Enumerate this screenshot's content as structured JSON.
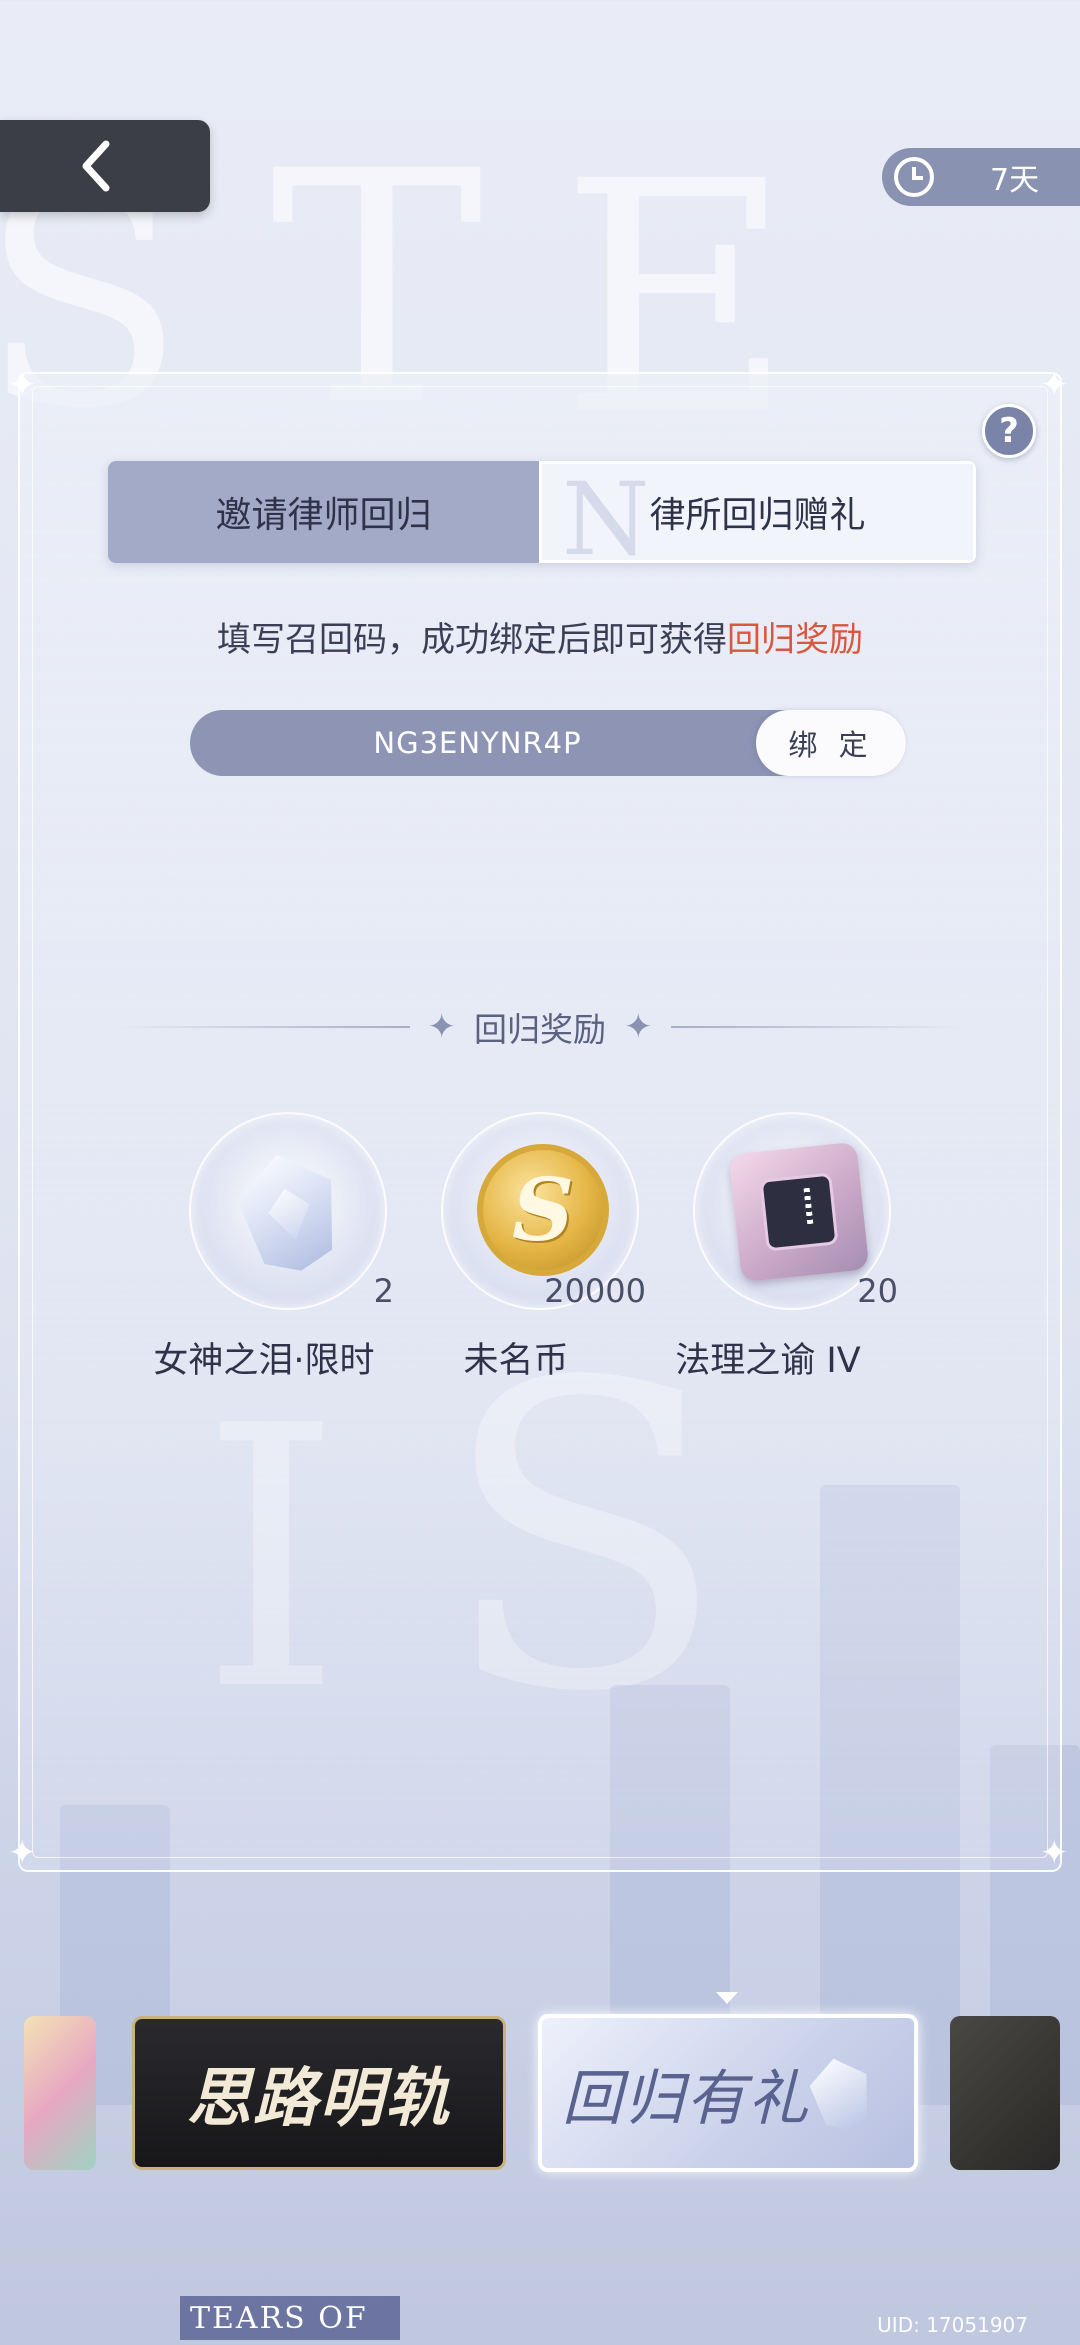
{
  "header": {
    "back_icon": "chevron-left-icon",
    "timer_icon": "clock-icon",
    "timer_label": "7天"
  },
  "help": {
    "label": "?"
  },
  "tabs": [
    {
      "label": "邀请律师回归",
      "active": true
    },
    {
      "label": "律所回归赠礼",
      "active": false
    }
  ],
  "instruction": {
    "text": "填写召回码，成功绑定后即可获得",
    "highlight": "回归奖励",
    "highlight_color": "#d9573f"
  },
  "code_input": {
    "value": "NG3ENYNR4P",
    "button_label": "绑 定"
  },
  "rewards_section": {
    "title": "回归奖励",
    "items": [
      {
        "name": "女神之泪·限时",
        "quantity": "2",
        "icon": "tear-gem-icon"
      },
      {
        "name": "未名币",
        "quantity": "20000",
        "icon": "gold-coin-icon"
      },
      {
        "name": "法理之谕 IV",
        "quantity": "20",
        "icon": "chip-card-icon"
      }
    ]
  },
  "carousel": {
    "cards": [
      {
        "label": ""
      },
      {
        "label": "思路明轨"
      },
      {
        "label": "回归有礼",
        "selected": true
      },
      {
        "label": ""
      }
    ]
  },
  "footer": {
    "brand": "TEARS OF",
    "uid": "UID: 17051907"
  },
  "colors": {
    "accent": "#8d94b4",
    "tab_active": "#a3aac7",
    "highlight": "#d9573f",
    "back_button": "#3c3e47"
  }
}
